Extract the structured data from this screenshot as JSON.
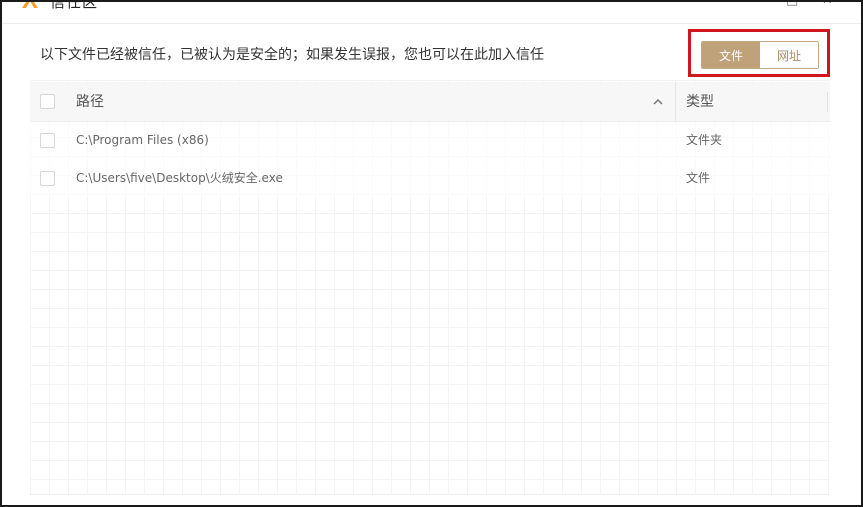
{
  "window": {
    "title": "信任区",
    "minimize": "—",
    "maximize": "□",
    "close": "✕"
  },
  "description": "以下文件已经被信任，已被认为是安全的；如果发生误报，您也可以在此加入信任",
  "tabs": [
    {
      "label": "文件",
      "active": true
    },
    {
      "label": "网址",
      "active": false
    }
  ],
  "table": {
    "headers": {
      "path": "路径",
      "type": "类型"
    },
    "rows": [
      {
        "path": "C:\\Program Files (x86)",
        "type": "文件夹"
      },
      {
        "path": "C:\\Users\\five\\Desktop\\火绒安全.exe",
        "type": "文件"
      }
    ]
  },
  "colors": {
    "accent": "#bfa17a",
    "highlight_border": "#d2161e"
  }
}
